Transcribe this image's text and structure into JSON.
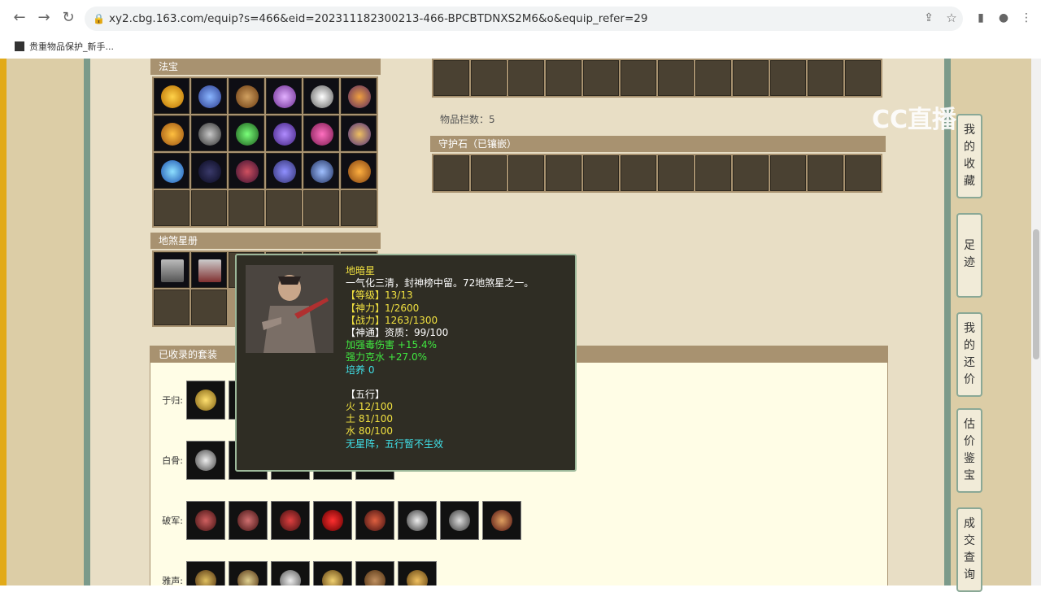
{
  "browser": {
    "url": "xy2.cbg.163.com/equip?s=466&eid=202311182300213-466-BPCBTDNXS2M6&o&equip_refer=29",
    "bookmark_label": "贵重物品保护_新手..."
  },
  "watermark": "CC直播",
  "sections": {
    "fabao_title": "法宝",
    "disha_title": "地煞星册",
    "guardstone_title": "守护石（已镶嵌）",
    "suits_title": "已收录的套装",
    "item_count_label": "物品栏数：5"
  },
  "suits": [
    {
      "label": "于归:"
    },
    {
      "label": "白骨:"
    },
    {
      "label": "破军:"
    },
    {
      "label": "雅声:"
    }
  ],
  "tooltip": {
    "name": "地暗星",
    "desc": "一气化三清，封神榜中留。72地煞星之一。",
    "level_key": "【等级】",
    "level_val": "13/13",
    "shenli_key": "【神力】",
    "shenli_val": "1/2600",
    "zhanli_key": "【战力】",
    "zhanli_val": "1263/1300",
    "shentong_key": "【神通】",
    "shentong_val": "资质：99/100",
    "bonus1": "加强毒伤害 +15.4%",
    "bonus2": "强力克水 +27.0%",
    "peiyang": "培养 0",
    "wuxing_title": "【五行】",
    "wx_fire": "火 12/100",
    "wx_earth": "土 81/100",
    "wx_water": "水 80/100",
    "wx_note": "无星阵，五行暂不生效"
  },
  "sidenav": {
    "fav": [
      "我",
      "的",
      "收",
      "藏"
    ],
    "track": [
      "足",
      "迹"
    ],
    "counter": [
      "我",
      "的",
      "还",
      "价"
    ],
    "appraise": [
      "估",
      "价",
      "鉴",
      "宝"
    ],
    "deals": [
      "成",
      "交",
      "查",
      "询"
    ]
  },
  "colors": {
    "accent_gold": "#a89270",
    "tooltip_bg": "#2f2d24",
    "tooltip_yellow": "#f0e040",
    "tooltip_green": "#40e840",
    "tooltip_cyan": "#40e0e8"
  }
}
